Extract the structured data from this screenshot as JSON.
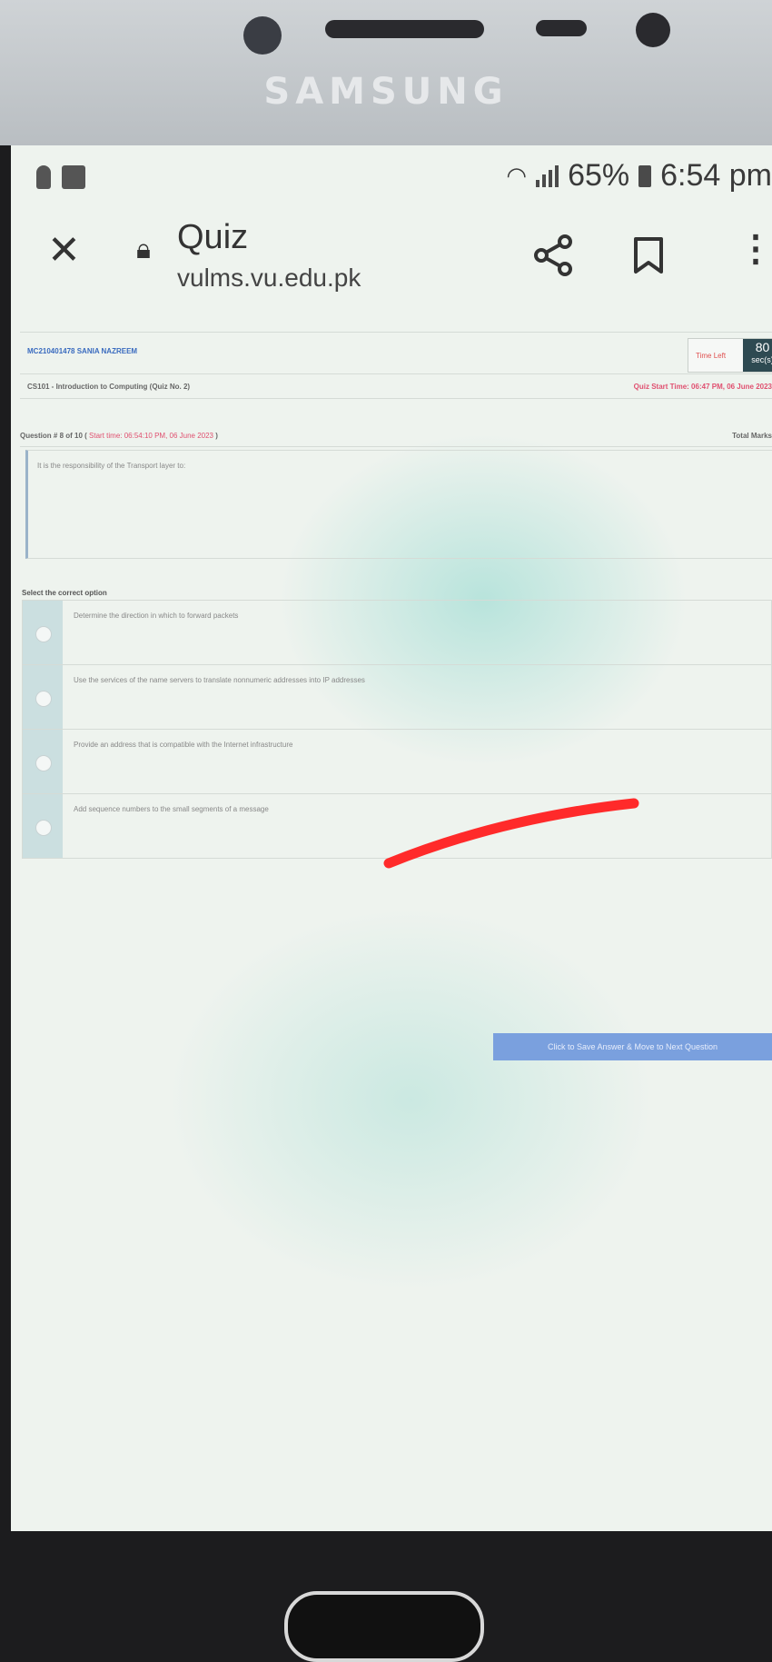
{
  "device": {
    "brand": "SAMSUNG"
  },
  "status_bar": {
    "battery": "65%",
    "time": "6:54 pm"
  },
  "toolbar": {
    "title": "Quiz",
    "url": "vulms.vu.edu.pk"
  },
  "quiz": {
    "student": "MC210401478 SANIA NAZREEM",
    "time_left_label": "Time Left",
    "time_left_value": "80",
    "time_left_unit": "sec(s)",
    "course": "CS101 - Introduction to Computing (Quiz No. 2)",
    "quiz_start": "Quiz Start Time: 06:47 PM, 06 June 2023",
    "question_number": "Question # 8 of 10 (",
    "question_start": "Start time: 06:54:10 PM, 06 June 2023",
    "question_close": ")",
    "total_marks_label": "Total Marks",
    "question_text": "It is the responsibility of the Transport layer to:",
    "select_label": "Select the correct option",
    "options": [
      "Determine the direction in which to forward packets",
      "Use the services of the name servers to translate nonnumeric addresses into IP addresses",
      "Provide an address that is compatible with the Internet infrastructure",
      "Add sequence numbers to the small segments of a message"
    ],
    "save_button": "Click to Save Answer & Move to Next Question"
  },
  "colors": {
    "accent_blue": "#7aa0de",
    "alert_red": "#e05070",
    "timer_bg": "#2e4a52",
    "annotation_red": "#ff2a2a"
  },
  "icons": [
    "close-icon",
    "lock-icon",
    "share-icon",
    "bookmark-icon",
    "more-vert-icon",
    "wifi-icon",
    "signal-icon",
    "battery-icon"
  ]
}
